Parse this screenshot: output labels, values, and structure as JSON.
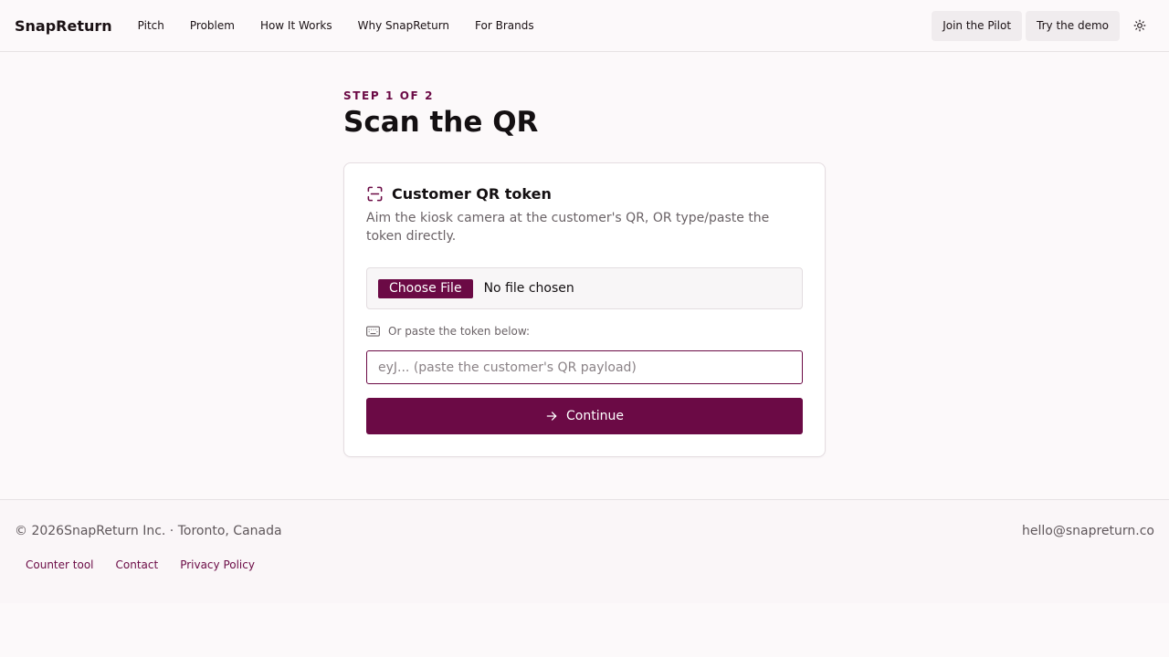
{
  "header": {
    "brand": "SnapReturn",
    "nav": [
      "Pitch",
      "Problem",
      "How It Works",
      "Why SnapReturn",
      "For Brands"
    ],
    "join_label": "Join the Pilot",
    "demo_label": "Try the demo",
    "theme_icon": "sun-icon"
  },
  "main": {
    "step": "STEP 1 OF 2",
    "title": "Scan the QR"
  },
  "card": {
    "title": "Customer QR token",
    "description": "Aim the kiosk camera at the customer's QR, OR type/paste the token directly.",
    "file_button": "Choose File",
    "file_status": "No file chosen",
    "paste_label": "Or paste the token below:",
    "token_placeholder": "eyJ... (paste the customer's QR payload)",
    "token_value": "",
    "continue_label": "Continue",
    "icons": {
      "title": "scan-qr-icon",
      "paste": "keyboard-icon",
      "continue": "arrow-right-icon"
    }
  },
  "footer": {
    "copyright": "© 2026SnapReturn Inc. · Toronto, Canada",
    "email": "hello@snapreturn.co",
    "links": [
      "Counter tool",
      "Contact",
      "Privacy Policy"
    ]
  },
  "colors": {
    "accent": "#6b0a45",
    "background": "#fcf9fa"
  }
}
